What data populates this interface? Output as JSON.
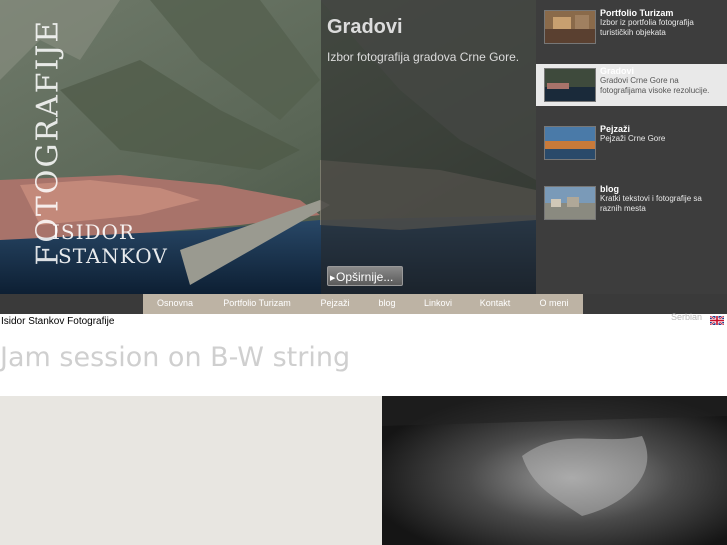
{
  "hero": {
    "vertical_text": "FOTOGRAFIJE",
    "signature_line1": "ISIDOR",
    "signature_line2": "STANKOV",
    "overlay_title": "Gradovi",
    "overlay_subtitle": "Izbor fotografija gradova Crne Gore.",
    "more_label": "Opširnije..."
  },
  "sidebar": {
    "items": [
      {
        "title": "Portfolio Turizam",
        "desc": "Izbor iz portfolia fotografija turističkih objekata",
        "active": false
      },
      {
        "title": "Gradovi",
        "desc": "Gradovi Crne Gore na fotografijama visoke rezolucije.",
        "active": true
      },
      {
        "title": "Pejzaži",
        "desc": "Pejzaži Crne Gore",
        "active": false
      },
      {
        "title": "blog",
        "desc": "Kratki tekstovi i fotografije sa raznih mesta",
        "active": false
      }
    ]
  },
  "nav": {
    "items": [
      "Osnovna",
      "Portfolio Turizam",
      "Pejzaži",
      "blog",
      "Linkovi",
      "Kontakt",
      "O meni"
    ]
  },
  "lang": {
    "serbian": "Serbian"
  },
  "site": {
    "name": "Isidor Stankov Fotografije"
  },
  "post": {
    "title": "Jam session on B-W string"
  },
  "colors": {
    "menu_bg": "#bdb3a4",
    "dark_bg": "#3a3a3a",
    "active_item_bg": "#e9e9e9"
  }
}
